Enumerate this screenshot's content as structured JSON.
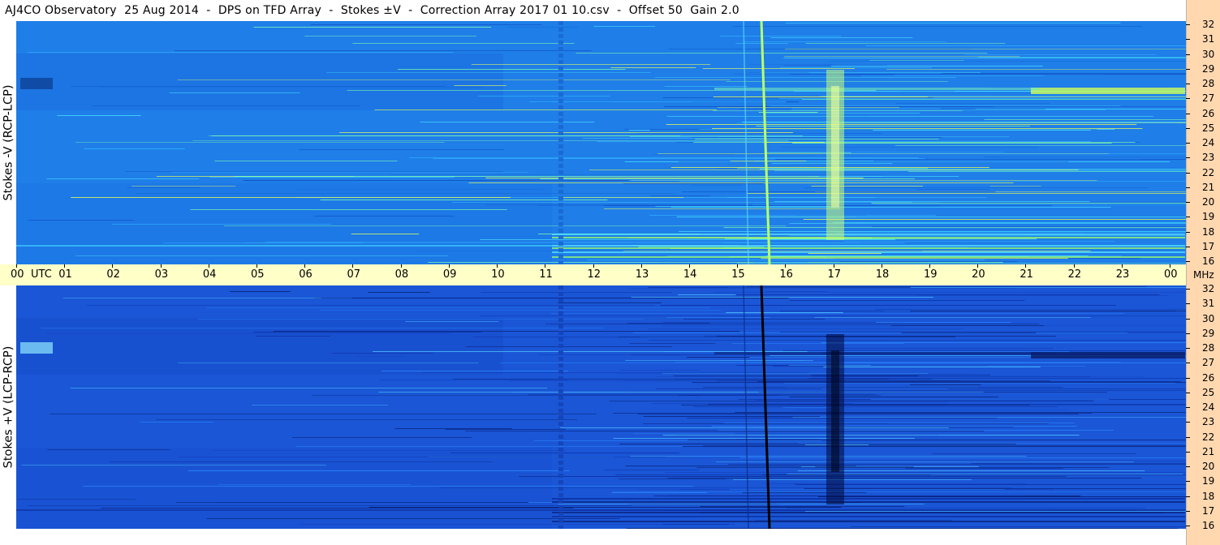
{
  "title": "AJ4CO Observatory  25 Aug 2014  -  DPS on TFD Array  -  Stokes ±V  -  Correction Array 2017 01 10.csv  -  Offset 50  Gain 2.0",
  "colors": {
    "panel_top_bg": "#1f7ee8",
    "panel_bottom_bg": "#1a56d6",
    "timebar_bg": "#ffffc8",
    "right_rail_bg": "#ffd8b0"
  },
  "chart_data": [
    {
      "type": "heatmap",
      "ylabel": "Stokes -V  (RCP-LCP)",
      "ylim": [
        16,
        32
      ],
      "y_ticks": [
        "32",
        "31",
        "30",
        "29",
        "28",
        "27",
        "26",
        "25",
        "24",
        "23",
        "22",
        "21",
        "20",
        "19",
        "18",
        "17",
        "16"
      ],
      "unit": "MHz",
      "x_range": [
        "00",
        "00"
      ],
      "grid": false
    },
    {
      "type": "heatmap",
      "ylabel": "Stokes +V  (LCP-RCP)",
      "ylim": [
        16,
        32
      ],
      "y_ticks": [
        "32",
        "31",
        "30",
        "29",
        "28",
        "27",
        "26",
        "25",
        "24",
        "23",
        "22",
        "21",
        "20",
        "19",
        "18",
        "17",
        "16"
      ],
      "unit": "MHz",
      "x_range": [
        "00",
        "00"
      ],
      "grid": false
    }
  ],
  "time_axis": {
    "ticks": [
      "00",
      "01",
      "02",
      "03",
      "04",
      "05",
      "06",
      "07",
      "08",
      "09",
      "10",
      "11",
      "12",
      "13",
      "14",
      "15",
      "16",
      "17",
      "18",
      "19",
      "20",
      "21",
      "22",
      "23",
      "00"
    ],
    "utc_label": "UTC",
    "unit": "MHz"
  }
}
